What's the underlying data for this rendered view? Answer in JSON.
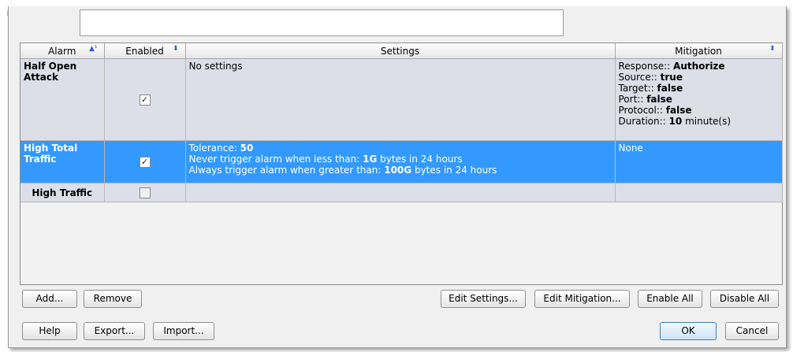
{
  "table": {
    "columns": [
      {
        "label": "Alarm",
        "sort_icon": "sort-ascending-icon"
      },
      {
        "label": "Enabled",
        "sort_icon": "sort-updown-icon"
      },
      {
        "label": "Settings"
      },
      {
        "label": "Mitigation",
        "sort_icon": "sort-updown-icon"
      }
    ],
    "sort_asc_glyph": "▲¹",
    "sort_updown_glyph": "⬍",
    "rows": [
      {
        "alarm": "Half Open Attack",
        "enabled": true,
        "settings_text": "No settings",
        "mitigation": [
          {
            "label": "Response::",
            "value": "Authorize"
          },
          {
            "label": "Source::",
            "value": "true"
          },
          {
            "label": "Target::",
            "value": "false"
          },
          {
            "label": "Port::",
            "value": "false"
          },
          {
            "label": "Protocol::",
            "value": "false"
          },
          {
            "label": "Duration::",
            "value": "10",
            "suffix": "minute(s)"
          }
        ]
      },
      {
        "alarm": "High Total Traffic",
        "enabled": true,
        "selected": true,
        "settings": [
          {
            "prefix": "Tolerance:",
            "value": "50",
            "suffix": ""
          },
          {
            "prefix": "Never trigger alarm when less than:",
            "value": "1G",
            "suffix": "bytes in 24 hours"
          },
          {
            "prefix": "Always trigger alarm when greater than:",
            "value": "100G",
            "suffix": "bytes in 24 hours"
          }
        ],
        "mitigation_text": "None"
      },
      {
        "alarm": "High Traffic",
        "enabled": false
      }
    ]
  },
  "check_glyph": "✓",
  "buttons": {
    "add": "Add...",
    "remove": "Remove",
    "edit_settings": "Edit Settings...",
    "edit_mitigation": "Edit Mitigation...",
    "enable_all": "Enable All",
    "disable_all": "Disable All",
    "help": "Help",
    "export": "Export...",
    "import": "Import...",
    "ok": "OK",
    "cancel": "Cancel"
  },
  "colors": {
    "row_background": "#dcdee8",
    "selected_row": "#3399ff",
    "dialog_background": "#f0f0f0"
  }
}
